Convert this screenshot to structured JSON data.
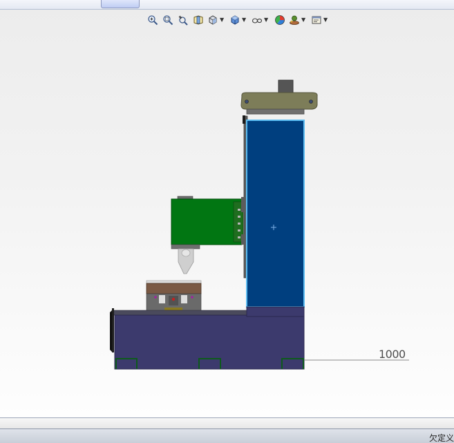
{
  "toolbar": {
    "icons": [
      "zoom-to-fit-icon",
      "zoom-to-area-icon",
      "previous-view-icon",
      "section-view-icon",
      "view-orientation-icon",
      "display-style-icon",
      "hide-show-items-icon",
      "edit-appearance-icon",
      "apply-scene-icon",
      "view-settings-icon"
    ]
  },
  "viewport": {
    "scale_label": "1000"
  },
  "status_bar": {
    "text": "欠定义"
  },
  "colors": {
    "column_blue": "#003f7f",
    "column_highlight": "#5bbcf2",
    "base_purple": "#3c3a6d",
    "head_green": "#017612",
    "cap_olive": "#7d7d59",
    "fixture_brown": "#7a5944"
  }
}
